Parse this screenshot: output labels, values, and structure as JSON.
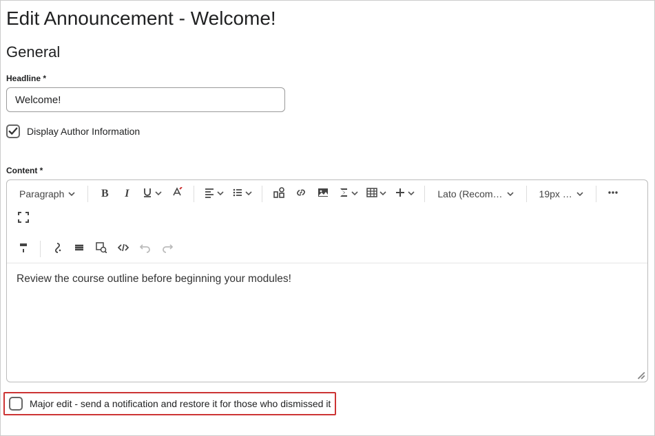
{
  "page": {
    "title": "Edit Announcement - Welcome!",
    "section_general": "General"
  },
  "headline": {
    "label": "Headline *",
    "value": "Welcome!"
  },
  "display_author": {
    "label": "Display Author Information",
    "checked": true
  },
  "content": {
    "label": "Content *",
    "body": "Review the course outline before beginning your modules!"
  },
  "toolbar": {
    "paragraph_label": "Paragraph",
    "font_label": "Lato (Recom…",
    "size_label": "19px …"
  },
  "major_edit": {
    "label": "Major edit - send a notification and restore it for those who dismissed it",
    "checked": false
  }
}
